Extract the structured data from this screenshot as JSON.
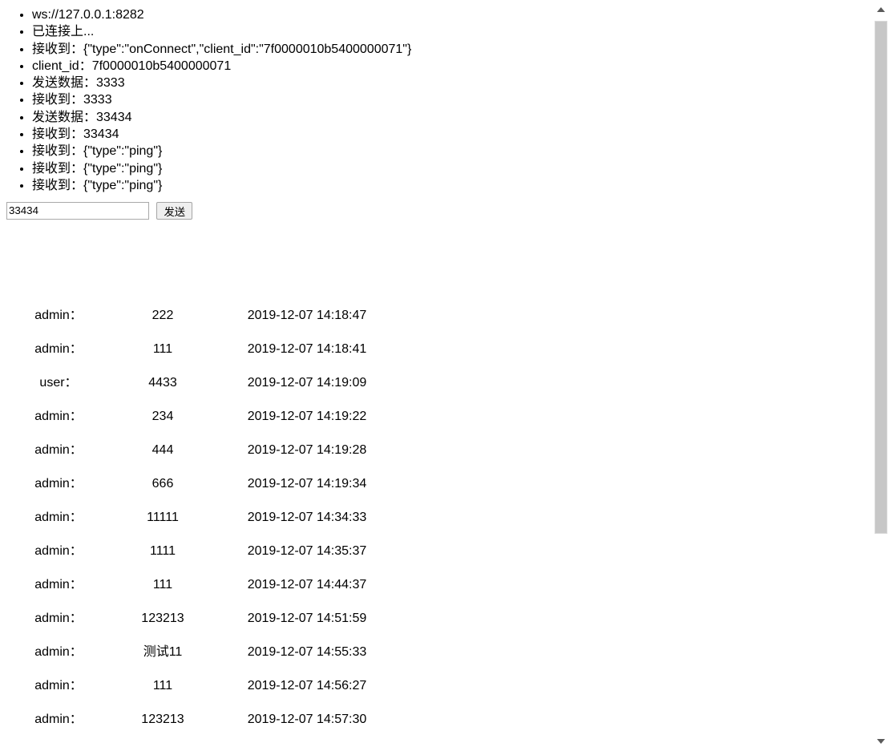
{
  "log": {
    "items": [
      "ws://127.0.0.1:8282",
      "已连接上...",
      "接收到：{\"type\":\"onConnect\",\"client_id\":\"7f0000010b5400000071\"}",
      "client_id：7f0000010b5400000071",
      "发送数据：3333",
      "接收到：3333",
      "发送数据：33434",
      "接收到：33434",
      "接收到：{\"type\":\"ping\"}",
      "接收到：{\"type\":\"ping\"}",
      "接收到：{\"type\":\"ping\"}"
    ]
  },
  "send_form": {
    "input_value": "33434",
    "input_placeholder": "",
    "button_label": "发送"
  },
  "messages": {
    "rows": [
      {
        "user": "admin：",
        "body": "222",
        "time": "2019-12-07 14:18:47"
      },
      {
        "user": "admin：",
        "body": "111",
        "time": "2019-12-07 14:18:41"
      },
      {
        "user": "user：",
        "body": "4433",
        "time": "2019-12-07 14:19:09"
      },
      {
        "user": "admin：",
        "body": "234",
        "time": "2019-12-07 14:19:22"
      },
      {
        "user": "admin：",
        "body": "444",
        "time": "2019-12-07 14:19:28"
      },
      {
        "user": "admin：",
        "body": "666",
        "time": "2019-12-07 14:19:34"
      },
      {
        "user": "admin：",
        "body": "11111",
        "time": "2019-12-07 14:34:33"
      },
      {
        "user": "admin：",
        "body": "1111",
        "time": "2019-12-07 14:35:37"
      },
      {
        "user": "admin：",
        "body": "111",
        "time": "2019-12-07 14:44:37"
      },
      {
        "user": "admin：",
        "body": "123213",
        "time": "2019-12-07 14:51:59"
      },
      {
        "user": "admin：",
        "body": "测试11",
        "time": "2019-12-07 14:55:33"
      },
      {
        "user": "admin：",
        "body": "111",
        "time": "2019-12-07 14:56:27"
      },
      {
        "user": "admin：",
        "body": "123213",
        "time": "2019-12-07 14:57:30"
      }
    ]
  },
  "scrollbar": {
    "up_arrow_icon": "triangle-up-icon",
    "down_arrow_icon": "triangle-down-icon"
  },
  "colors": {
    "background": "#ffffff",
    "text": "#000000",
    "scrollbar_thumb": "#c7c7c7",
    "input_border": "#a9a9a9",
    "button_face": "#efefef"
  }
}
